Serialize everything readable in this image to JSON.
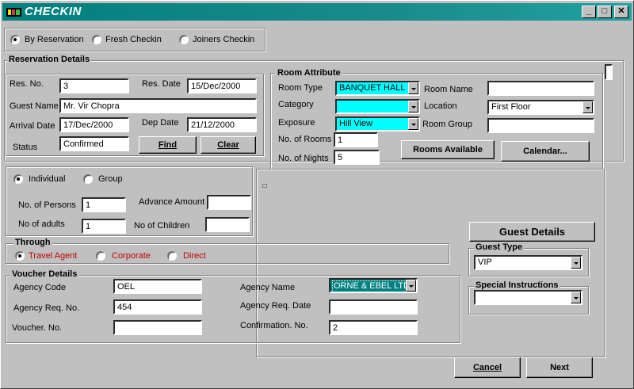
{
  "window": {
    "title": "CHECKIN",
    "min": "_",
    "max": "□",
    "close": "✕"
  },
  "mode": {
    "options": [
      "By Reservation",
      "Fresh Checkin",
      "Joiners Checkin"
    ],
    "selected": 0
  },
  "reservation": {
    "legend": "Reservation Details",
    "res_no_label": "Res. No.",
    "res_no": "3",
    "res_date_label": "Res. Date",
    "res_date": "15/Dec/2000",
    "guest_name_label": "Guest Name",
    "guest_name": "Mr. Vir Chopra",
    "arrival_label": "Arrival Date",
    "arrival": "17/Dec/2000",
    "dep_label": "Dep Date",
    "dep": "21/12/2000",
    "status_label": "Status",
    "status": "Confirmed",
    "find": "Find",
    "clear": "Clear"
  },
  "room": {
    "legend": "Room Attribute",
    "room_type_label": "Room Type",
    "room_type": "BANQUET HALL",
    "room_name_label": "Room Name",
    "room_name": "",
    "category_label": "Category",
    "category": "",
    "location_label": "Location",
    "location": "First Floor",
    "exposure_label": "Exposure",
    "exposure": "Hill View",
    "room_group_label": "Room Group",
    "room_group": "",
    "rooms_label": "No. of Rooms",
    "rooms": "1",
    "nights_label": "No. of Nights",
    "nights": "5",
    "rooms_available": "Rooms Available",
    "calendar": "Calendar..."
  },
  "guests": {
    "type_options": [
      "Individual",
      "Group"
    ],
    "type_selected": 0,
    "persons_label": "No. of Persons",
    "persons": "1",
    "advance_label": "Advance Amount",
    "advance": "",
    "adults_label": "No of adults",
    "adults": "1",
    "children_label": "No of Children",
    "children": ""
  },
  "through": {
    "legend": "Through",
    "options": [
      "Travel Agent",
      "Corporate",
      "Direct"
    ],
    "selected": 0
  },
  "voucher": {
    "legend": "Voucher Details",
    "agency_code_label": "Agency Code",
    "agency_code": "OEL",
    "agency_name_label": "Agency Name",
    "agency_name": "ORNE & EBEL LTD",
    "agency_req_no_label": "Agency Req. No.",
    "agency_req_no": "454",
    "agency_req_date_label": "Agency Req. Date",
    "agency_req_date": "",
    "voucher_no_label": "Voucher. No.",
    "voucher_no": "",
    "confirmation_label": "Confirmation. No.",
    "confirmation": "2"
  },
  "guest_details": {
    "button": "Guest Details",
    "type_legend": "Guest Type",
    "type": "VIP",
    "special_legend": "Special Instructions",
    "special": ""
  },
  "footer": {
    "cancel": "Cancel",
    "next": "Next"
  },
  "colors": {
    "title_bar": "#008080",
    "highlight_field": "#00ffff",
    "through_text": "#c00000"
  }
}
